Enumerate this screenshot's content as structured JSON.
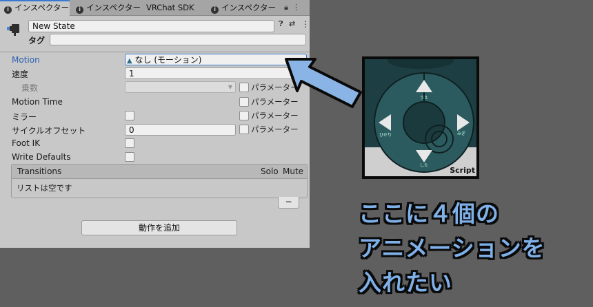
{
  "tabs": [
    {
      "label": "インスペクター",
      "icon": "info-icon",
      "active": true
    },
    {
      "label": "インスペクター",
      "icon": "info-icon",
      "active": false
    },
    {
      "label": "VRChat SDK",
      "icon": "",
      "active": false
    },
    {
      "label": "インスペクター",
      "icon": "info-icon",
      "active": false
    }
  ],
  "tab_icons": {
    "lock": "lock-icon",
    "menu": "kebab-menu-icon"
  },
  "header": {
    "name_value": "New State",
    "tag_label": "タグ",
    "tag_value": "",
    "icons": [
      "help-icon",
      "preset-icon",
      "kebab-menu-icon"
    ]
  },
  "rows": {
    "motion_label": "Motion",
    "motion_value": "なし (モーション)",
    "speed_label": "速度",
    "speed_value": "1",
    "multiplier_label": "乗数",
    "multiplier_param": "パラメーター",
    "motion_time_label": "Motion Time",
    "motion_time_param": "パラメーター",
    "mirror_label": "ミラー",
    "mirror_param": "パラメーター",
    "cycle_offset_label": "サイクルオフセット",
    "cycle_offset_value": "0",
    "cycle_offset_param": "パラメーター",
    "foot_ik_label": "Foot IK",
    "write_defaults_label": "Write Defaults"
  },
  "transitions": {
    "title": "Transitions",
    "solo": "Solo",
    "mute": "Mute",
    "empty_text": "リストは空です",
    "remove_label": "−"
  },
  "add_behaviour_label": "動作を追加",
  "thumbnail": {
    "left": "ひだり",
    "right": "みぎ",
    "up": "うえ",
    "down": "した",
    "corner_text": "Script"
  },
  "caption": {
    "line1": "ここに４個の",
    "line2": "アニメーションを",
    "line3": "入れたい"
  },
  "colors": {
    "accent_blue": "#3a79d3",
    "arrow_blue": "#8ab4e6",
    "caption_blue": "#7fb0e8",
    "panel_bg": "#c8c8c8",
    "page_bg": "#5f5f5f"
  }
}
